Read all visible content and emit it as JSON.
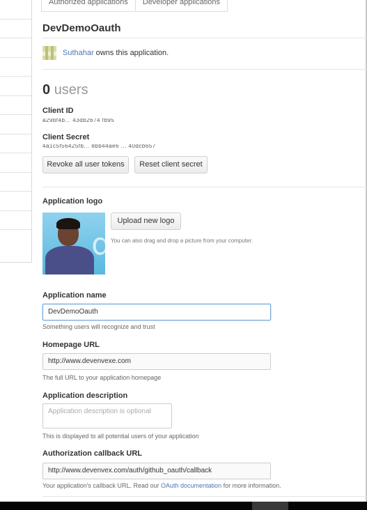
{
  "tabs": [
    "Authorized applications",
    "Developer applications"
  ],
  "app": {
    "title": "DevDemoOauth",
    "owner_name": "Suthahar",
    "owner_text": "owns this application."
  },
  "users": {
    "count": "0",
    "label": "users"
  },
  "credentials": {
    "client_id_label": "Client ID",
    "client_id_value": "a29bf4b... 43db2674 fb95",
    "client_secret_label": "Client Secret",
    "client_secret_value": "4a1c5f56425fb... 8bb44ae6 ... 40dcb657"
  },
  "buttons": {
    "revoke": "Revoke all user tokens",
    "reset": "Reset client secret",
    "upload": "Upload new logo"
  },
  "logo": {
    "label": "Application logo",
    "hint": "You can also drag and drop a picture from your computer."
  },
  "form": {
    "name_label": "Application name",
    "name_value": "DevDemoOauth",
    "name_note": "Something users will recognize and trust",
    "homepage_label": "Homepage URL",
    "homepage_value": "http://www.devenvexe.com",
    "homepage_note": "The full URL to your application homepage",
    "description_label": "Application description",
    "description_placeholder": "Application description is optional",
    "description_note": "This is displayed to all potential users of your application",
    "callback_label": "Authorization callback URL",
    "callback_value": "http://www.devenvex.com/auth/github_oauth/callback",
    "callback_note_pre": "Your application's callback URL. Read our",
    "callback_note_link": "OAuth documentation",
    "callback_note_post": "for more information."
  }
}
